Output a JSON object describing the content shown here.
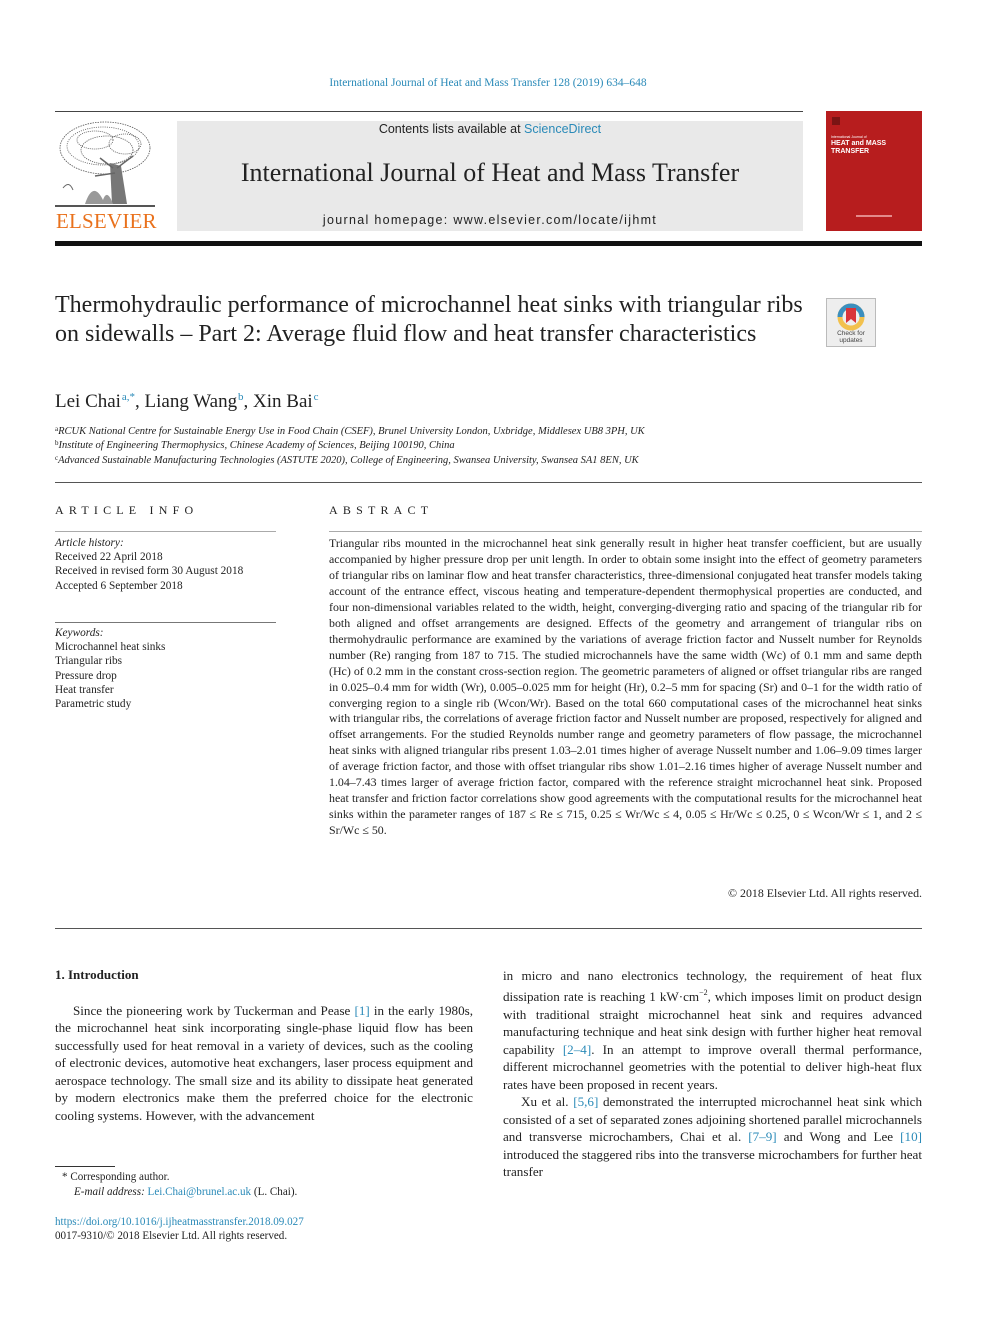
{
  "running_head": "International Journal of Heat and Mass Transfer 128 (2019) 634–648",
  "masthead": {
    "publisher_logo_text": "ELSEVIER",
    "contents_prefix": "Contents lists available at ",
    "contents_link": "ScienceDirect",
    "journal_title": "International Journal of Heat and Mass Transfer",
    "homepage": "journal homepage: www.elsevier.com/locate/ijhmt",
    "cover": {
      "line1": "International Journal of",
      "line2": "HEAT and MASS",
      "line3": "TRANSFER"
    },
    "brand_color": "#e9711c",
    "cover_color": "#b71d1e",
    "link_color": "#2a8ab8"
  },
  "article": {
    "title": "Thermohydraulic performance of microchannel heat sinks with triangular ribs on sidewalls – Part 2: Average fluid flow and heat transfer characteristics",
    "crossmark_label_1": "Check for",
    "crossmark_label_2": "updates",
    "authors": [
      {
        "name": "Lei Chai",
        "sup": "a,*"
      },
      {
        "name": "Liang Wang",
        "sup": "b"
      },
      {
        "name": "Xin Bai",
        "sup": "c"
      }
    ],
    "affiliations": [
      {
        "key": "a",
        "text": "RCUK National Centre for Sustainable Energy Use in Food Chain (CSEF), Brunel University London, Uxbridge, Middlesex UB8 3PH, UK"
      },
      {
        "key": "b",
        "text": "Institute of Engineering Thermophysics, Chinese Academy of Sciences, Beijing 100190, China"
      },
      {
        "key": "c",
        "text": "Advanced Sustainable Manufacturing Technologies (ASTUTE 2020), College of Engineering, Swansea University, Swansea SA1 8EN, UK"
      }
    ]
  },
  "article_info": {
    "heading": "ARTICLE INFO",
    "history_label": "Article history:",
    "history": [
      "Received 22 April 2018",
      "Received in revised form 30 August 2018",
      "Accepted 6 September 2018"
    ],
    "keywords_label": "Keywords:",
    "keywords": [
      "Microchannel heat sinks",
      "Triangular ribs",
      "Pressure drop",
      "Heat transfer",
      "Parametric study"
    ]
  },
  "abstract": {
    "heading": "ABSTRACT",
    "text": "Triangular ribs mounted in the microchannel heat sink generally result in higher heat transfer coefficient, but are usually accompanied by higher pressure drop per unit length. In order to obtain some insight into the effect of geometry parameters of triangular ribs on laminar flow and heat transfer characteristics, three-dimensional conjugated heat transfer models taking account of the entrance effect, viscous heating and temperature-dependent thermophysical properties are conducted, and four non-dimensional vari­ables related to the width, height, converging-diverging ratio and spacing of the triangular rib for both aligned and offset arrangements are designed. Effects of the geometry and arrangement of triangular ribs on thermohydraulic performance are examined by the variations of average friction factor and Nusselt number for Reynolds number (Re) ranging from 187 to 715. The studied microchannels have the same width (Wc) of 0.1 mm and same depth (Hc) of 0.2 mm in the constant cross-section region. The geometric parameters of aligned or offset triangular ribs are ranged in 0.025–0.4 mm for width (Wr), 0.005–0.025 mm for height (Hr), 0.2–5 mm for spacing (Sr) and 0–1 for the width ratio of converging region to a single rib (Wcon/Wr). Based on the total 660 computational cases of the microchannel heat sinks with triangular ribs, the correlations of average friction factor and Nusselt number are proposed, respectively for aligned and offset arrangements. For the studied Reynolds number range and geometry parameters of flow passage, the microchannel heat sinks with aligned triangular ribs present 1.03–2.01 times higher of average Nusselt number and 1.06–9.09 times larger of average friction factor, and those with offset tri­angular ribs show 1.01–2.16 times higher of average Nusselt number and 1.04–7.43 times larger of aver­age friction factor, compared with the reference straight microchannel heat sink. Proposed heat transfer and friction factor correlations show good agreements with the computational results for the microchan­nel heat sinks within the parameter ranges of 187 ≤ Re ≤ 715, 0.25 ≤ Wr/Wc ≤ 4, 0.05 ≤ Hr/Wc ≤ 0.25, 0 ≤ Wcon/Wr ≤ 1, and 2 ≤ Sr/Wc ≤ 50.",
    "copyright": "© 2018 Elsevier Ltd. All rights reserved."
  },
  "introduction": {
    "heading": "1. Introduction",
    "p1_a": "Since the pioneering work by Tuckerman and Pease ",
    "p1_ref1": "[1]",
    "p1_b": " in the early 1980s, the microchannel heat sink incorporating single-phase liquid flow has been successfully used for heat removal in a variety of devices, such as the cooling of electronic devices, auto­motive heat exchangers, laser process equipment and aerospace technology. The small size and its ability to dissipate heat gener­ated by modern electronics make them the preferred choice for the electronic cooling systems. However, with the advancement",
    "p1_c": "in micro and nano electronics technology, the requirement of heat flux dissipation rate is reaching 1 kW·cm",
    "p1_sup": "−2",
    "p1_d": ", which imposes limit on product design with traditional straight microchannel heat sink and requires advanced manufacturing technique and heat sink design with further higher heat removal capability ",
    "p1_ref2": "[2–4]",
    "p1_e": ". In an attempt to improve overall thermal performance, different microchannel geometries with the potential to deliver high-heat flux rates have been proposed in recent years.",
    "p2_a": "Xu et al. ",
    "p2_ref1": "[5,6]",
    "p2_b": " demonstrated the interrupted microchannel heat sink which consisted of a set of separated zones adjoining short­ened parallel microchannels and transverse microchambers, Chai et al. ",
    "p2_ref2": "[7–9]",
    "p2_c": " and Wong and Lee ",
    "p2_ref3": "[10]",
    "p2_d": " introduced the staggered ribs into the transverse microchambers for further heat transfer"
  },
  "footnotes": {
    "corresponding": "* Corresponding author.",
    "email_label": "E-mail address: ",
    "email": "Lei.Chai@brunel.ac.uk",
    "email_suffix": " (L. Chai).",
    "doi": "https://doi.org/10.1016/j.ijheatmasstransfer.2018.09.027",
    "issn": "0017-9310/© 2018 Elsevier Ltd. All rights reserved."
  }
}
